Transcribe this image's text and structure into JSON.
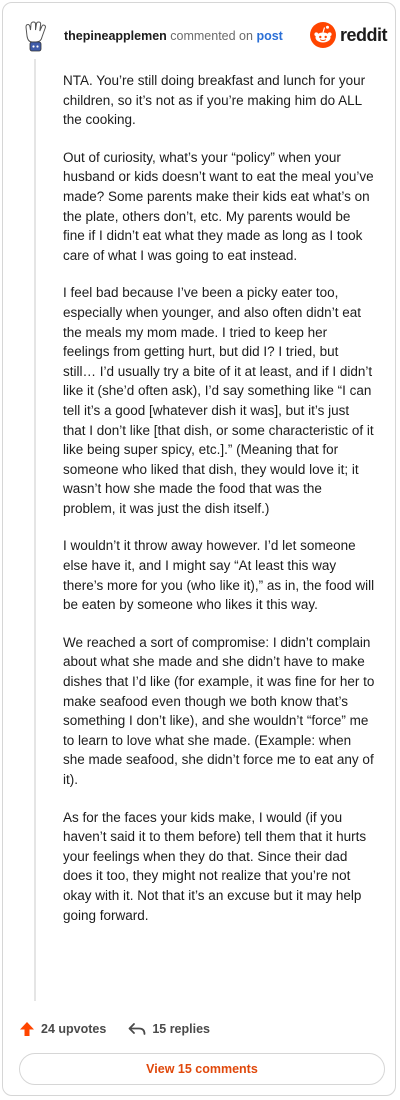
{
  "header": {
    "username": "thepineapplemen",
    "action_text": "commented on",
    "target_link": "post",
    "brand_name": "reddit"
  },
  "comment": {
    "paragraphs": [
      "NTA. You’re still doing breakfast and lunch for your children, so it’s not as if you’re making him do ALL the cooking.",
      "Out of curiosity, what’s your “policy” when your husband or kids doesn’t want to eat the meal you’ve made? Some parents make their kids eat what’s on the plate, others don’t, etc. My parents would be fine if I didn’t eat what they made as long as I took care of what I was going to eat instead.",
      "I feel bad because I’ve been a picky eater too, especially when younger, and also often didn’t eat the meals my mom made. I tried to keep her feelings from getting hurt, but did I? I tried, but still… I’d usually try a bite of it at least, and if I didn’t like it (she’d often ask), I’d say something like “I can tell it’s a good [whatever dish it was], but it’s just that I don’t like [that dish, or some characteristic of it like being super spicy, etc.].” (Meaning that for someone who liked that dish, they would love it; it wasn’t how she made the food that was the problem, it was just the dish itself.)",
      "I wouldn’t it throw away however. I’d let someone else have it, and I might say “At least this way there’s more for you (who like it),” as in, the food will be eaten by someone who likes it this way.",
      "We reached a sort of compromise: I didn’t complain about what she made and she didn’t have to make dishes that I’d like (for example, it was fine for her to make seafood even though we both know that’s something I don’t like), and she wouldn’t “force” me to learn to love what she made. (Example: when she made seafood, she didn’t force me to eat any of it).",
      "As for the faces your kids make, I would (if you haven’t said it to them before) tell them that it hurts your feelings when they do that. Since their dad does it too, they might not realize that you’re not okay with it. Not that it’s an excuse but it may help going forward."
    ]
  },
  "actions": {
    "upvotes_label": "24 upvotes",
    "replies_label": "15 replies"
  },
  "footer": {
    "view_comments_label": "View 15 comments"
  },
  "colors": {
    "brand": "#ff4500",
    "link": "#2a6fd6",
    "view_button_text": "#e0480b"
  },
  "icons": {
    "avatar": "snoo-avatar-icon",
    "brand": "reddit-logo-icon",
    "upvote": "upvote-arrow-icon",
    "reply": "reply-arrow-icon"
  }
}
